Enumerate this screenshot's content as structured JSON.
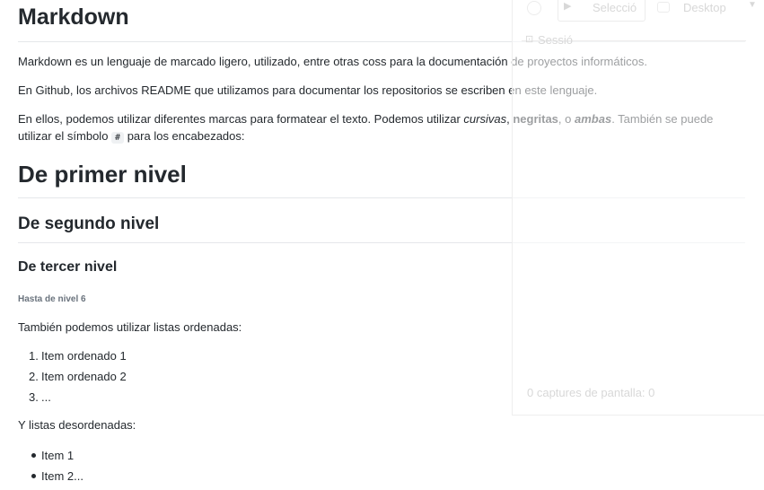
{
  "doc": {
    "title": "Markdown",
    "p1": "Markdown es un lenguaje de marcado ligero, utilizado, entre otras coss para la documentación de proyectos informáticos.",
    "p2": "En Github, los archivos README que utilizamos para documentar los repositorios se escriben en este lenguaje.",
    "p3_a": "En ellos, podemos utilizar diferentes marcas para formatear el texto. Podemos utilizar ",
    "p3_italic": "cursivas",
    "p3_b": ", ",
    "p3_bold": "negritas",
    "p3_c": ", o ",
    "p3_bolditalic": "ambas",
    "p3_d": ". También se puede utilizar el símbolo ",
    "p3_code": "#",
    "p3_e": " para los encabezados:",
    "h1": "De primer nivel",
    "h2": "De segundo nivel",
    "h3": "De tercer nivel",
    "h6": "Hasta de nivel 6",
    "ordered_intro": "También podemos utilizar listas ordenadas:",
    "ordered": [
      {
        "num": "1.",
        "text": "Item ordenado 1"
      },
      {
        "num": "2.",
        "text": "Item ordenado 2"
      },
      {
        "num": "3.",
        "text": "..."
      }
    ],
    "unordered_intro": "Y listas desordenadas:",
    "unordered": [
      "Item 1",
      "Item 2..."
    ]
  },
  "overlay": {
    "selection_label": "Selecció",
    "desktop_label": "Desktop",
    "session_label": "Sessió",
    "captures_label": "0 captures de pantalla: 0"
  }
}
